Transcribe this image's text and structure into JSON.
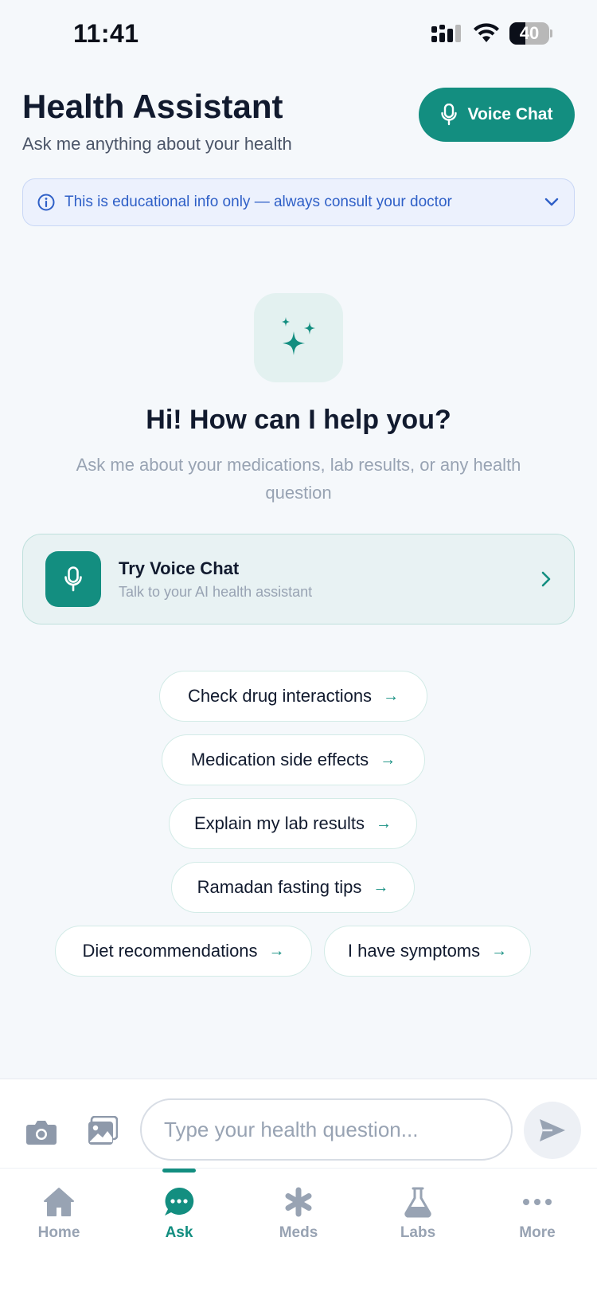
{
  "status_bar": {
    "time": "11:41",
    "battery": "40"
  },
  "header": {
    "title": "Health Assistant",
    "subtitle": "Ask me anything about your health",
    "voice_chat_label": "Voice Chat"
  },
  "disclaimer": {
    "text": "This is educational info only — always consult your doctor"
  },
  "hero": {
    "title": "Hi! How can I help you?",
    "subtitle": "Ask me about your medications, lab results, or any health question"
  },
  "voice_card": {
    "title": "Try Voice Chat",
    "subtitle": "Talk to your AI health assistant"
  },
  "suggestions": [
    "Check drug interactions",
    "Medication side effects",
    "Explain my lab results",
    "Ramadan fasting tips",
    "Diet recommendations",
    "I have symptoms"
  ],
  "input": {
    "placeholder": "Type your health question..."
  },
  "tabs": [
    {
      "label": "Home",
      "icon": "home-icon",
      "active": false
    },
    {
      "label": "Ask",
      "icon": "chat-bubble-icon",
      "active": true
    },
    {
      "label": "Meds",
      "icon": "asterisk-icon",
      "active": false
    },
    {
      "label": "Labs",
      "icon": "flask-icon",
      "active": false
    },
    {
      "label": "More",
      "icon": "more-dots-icon",
      "active": false
    }
  ],
  "colors": {
    "accent": "#138e80",
    "muted": "#98a3b3",
    "info": "#2e5fc7",
    "background": "#f5f8fb"
  }
}
